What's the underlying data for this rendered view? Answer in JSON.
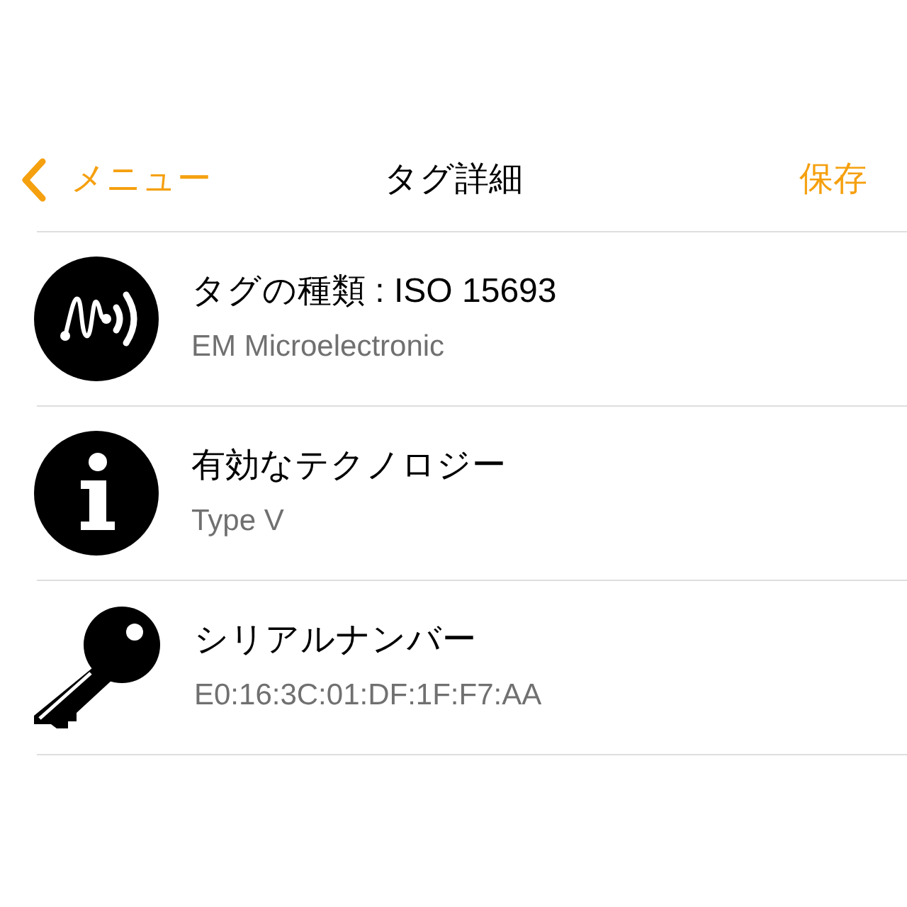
{
  "nav": {
    "back_label": "メニュー",
    "title": "タグ詳細",
    "save_label": "保存"
  },
  "rows": [
    {
      "kind": "nfc",
      "title": "タグの種類 : ISO 15693",
      "subtitle": "EM Microelectronic"
    },
    {
      "kind": "info",
      "title": "有効なテクノロジー",
      "subtitle": "Type V"
    },
    {
      "kind": "key",
      "title": "シリアルナンバー",
      "subtitle": "E0:16:3C:01:DF:1F:F7:AA"
    }
  ]
}
